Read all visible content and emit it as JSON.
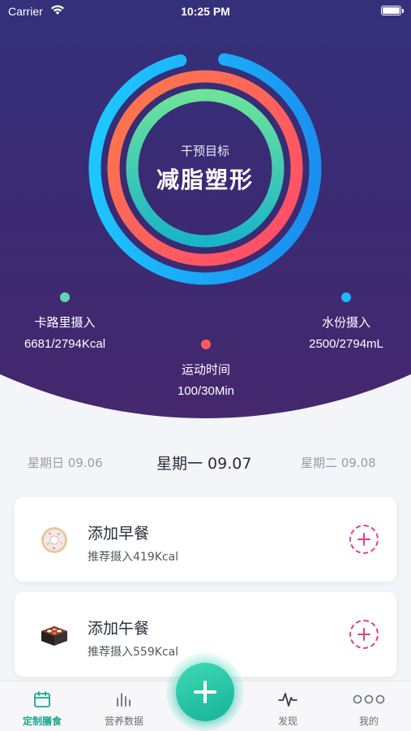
{
  "status_bar": {
    "carrier": "Carrier",
    "time": "10:25 PM"
  },
  "goal": {
    "subtitle": "干预目标",
    "title": "减脂塑形"
  },
  "stats": {
    "calories": {
      "label": "卡路里摄入",
      "value": "6681/2794Kcal",
      "color": "#5fd6b0"
    },
    "exercise": {
      "label": "运动时间",
      "value": "100/30Min",
      "color": "#ff5a5a"
    },
    "water": {
      "label": "水份摄入",
      "value": "2500/2794mL",
      "color": "#1fb8ff"
    }
  },
  "dates": {
    "prev": "星期日 09.06",
    "current": "星期一 09.07",
    "next": "星期二 09.08"
  },
  "meals": [
    {
      "title": "添加早餐",
      "hint": "推荐摄入419Kcal",
      "icon": "donut-icon"
    },
    {
      "title": "添加午餐",
      "hint": "推荐摄入559Kcal",
      "icon": "bento-icon"
    }
  ],
  "tabs": [
    {
      "label": "定制膳食",
      "icon": "calendar-icon"
    },
    {
      "label": "营养数据",
      "icon": "bar-chart-icon"
    },
    {
      "label": "发现",
      "icon": "pulse-icon"
    },
    {
      "label": "我的",
      "icon": "more-dots-icon"
    }
  ],
  "colors": {
    "accent": "#1aa68e",
    "add": "#e0418a",
    "hero_top": "#2a3f8f",
    "hero_bottom": "#45286e"
  }
}
